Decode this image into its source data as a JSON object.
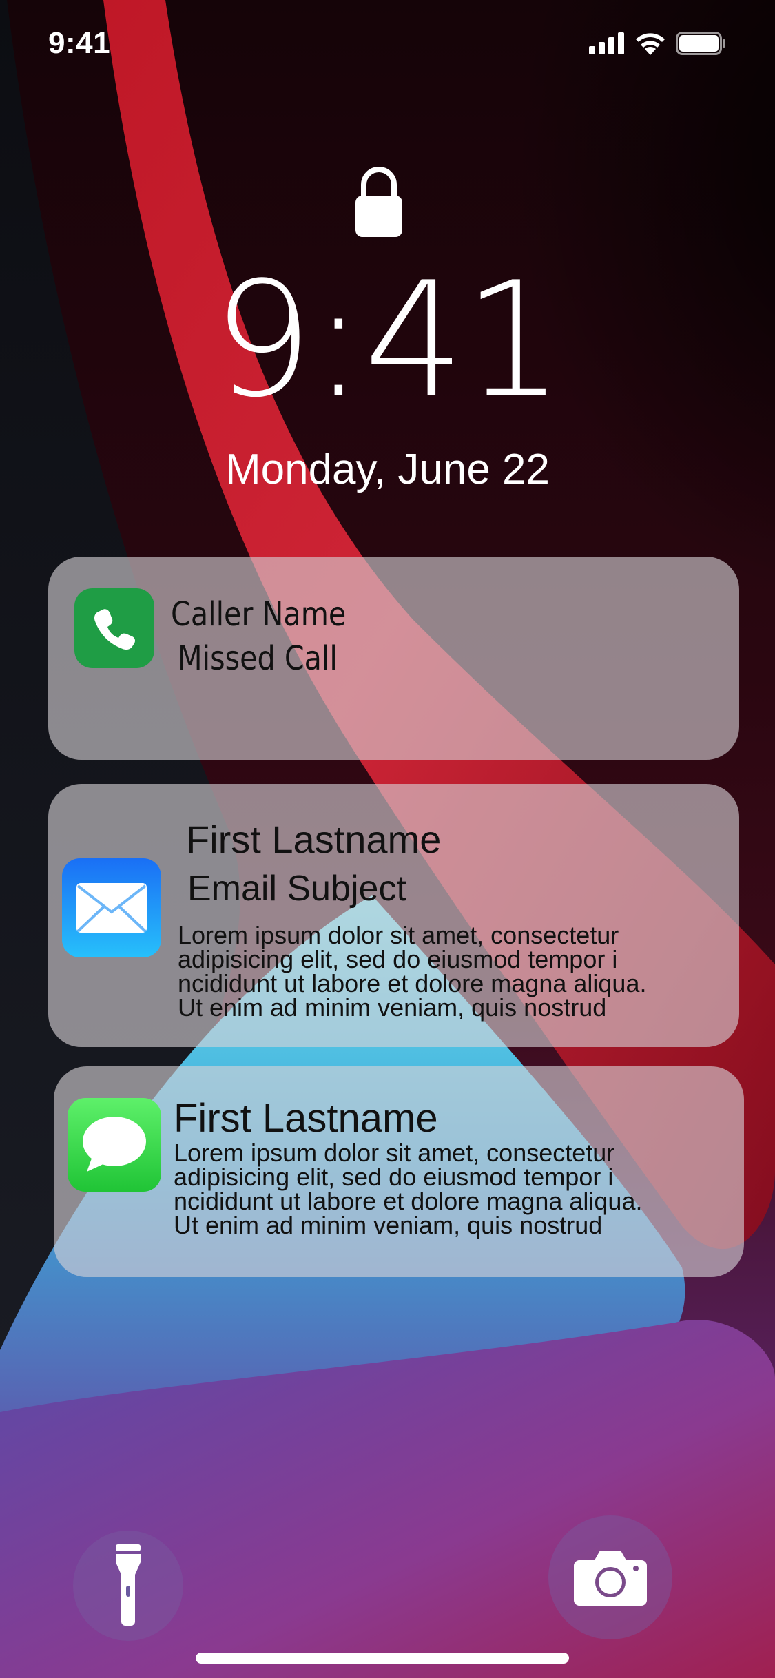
{
  "status_bar": {
    "time": "9:41"
  },
  "lock_screen": {
    "time": "9:41",
    "date": "Monday, June 22"
  },
  "notifications": [
    {
      "app_icon": "phone-icon",
      "title": "Caller Name",
      "subtitle": "Missed Call"
    },
    {
      "app_icon": "mail-icon",
      "title": "First Lastname",
      "subject": "Email Subject",
      "body_lines": [
        "Lorem ipsum dolor sit amet, consectetur",
        " adipisicing elit, sed do eiusmod tempor i",
        "ncididunt ut labore et dolore magna aliqua.",
        "Ut enim ad minim veniam, quis nostrud"
      ]
    },
    {
      "app_icon": "messages-icon",
      "title": "First Lastname",
      "body_lines": [
        "Lorem ipsum dolor sit amet, consectetur",
        " adipisicing elit, sed do eiusmod tempor i",
        "ncididunt ut labore et dolore magna aliqua.",
        "Ut enim ad minim veniam, quis nostrud"
      ]
    }
  ],
  "controls": {
    "left": "flashlight-icon",
    "right": "camera-icon"
  },
  "colors": {
    "phone_green": "#1f9d45",
    "mail_blue": "#1a6ff5",
    "messages_green": "#20c436"
  }
}
